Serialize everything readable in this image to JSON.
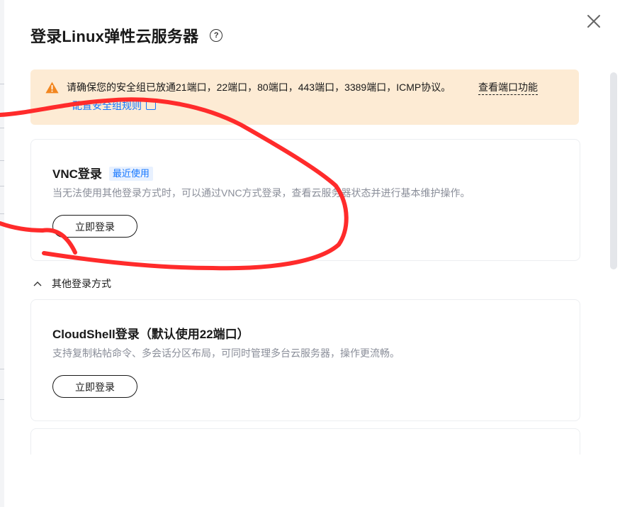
{
  "dialog": {
    "title": "登录Linux弹性云服务器",
    "help_icon": "question-circle-icon",
    "close_icon": "close-icon"
  },
  "alert": {
    "icon": "warning-triangle-icon",
    "text": "请确保您的安全组已放通21端口，22端口，80端口，443端口，3389端口，ICMP协议。",
    "link_ports": "查看端口功能",
    "link_rules": "配置安全组规则",
    "link_rules_icon": "external-link-icon"
  },
  "vnc_card": {
    "title": "VNC登录",
    "tag": "最近使用",
    "description": "当无法使用其他登录方式时，可以通过VNC方式登录，查看云服务器状态并进行基本维护操作。",
    "button": "立即登录"
  },
  "other_methods": {
    "label": "其他登录方式",
    "icon": "chevron-up-icon"
  },
  "cloudshell_card": {
    "title": "CloudShell登录（默认使用22端口）",
    "description": "支持复制粘帖命令、多会话分区布局，可同时管理多台云服务器，操作更流畅。",
    "button": "立即登录"
  },
  "colors": {
    "accent": "#1476ff",
    "alert_bg": "#fdebd4",
    "warning": "#f2861f",
    "annotation": "#ff2b2b"
  }
}
